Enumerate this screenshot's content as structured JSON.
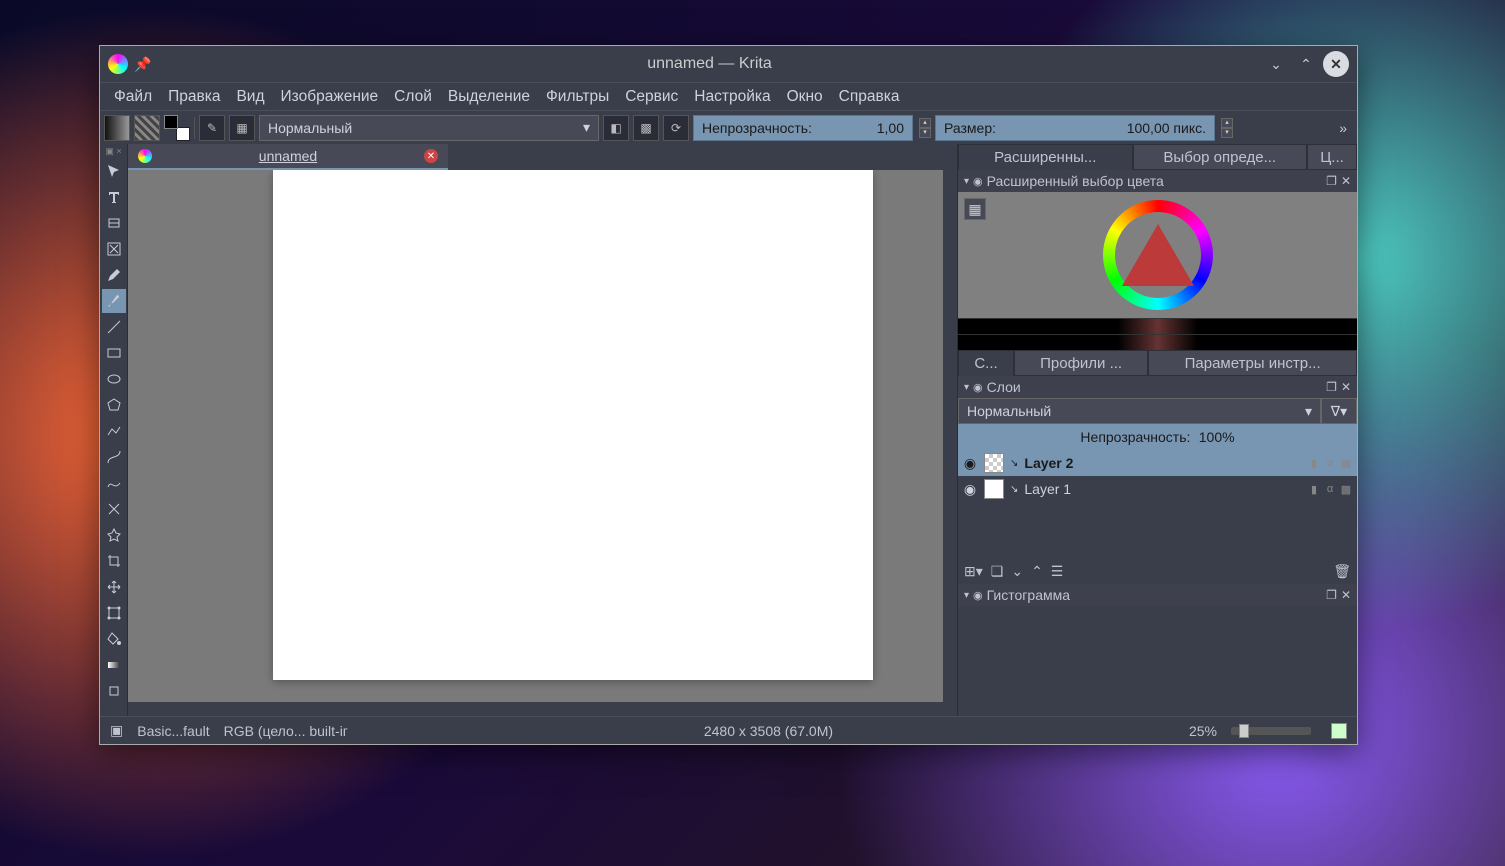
{
  "window": {
    "title": "unnamed  — Krita"
  },
  "menu": [
    "Файл",
    "Правка",
    "Вид",
    "Изображение",
    "Слой",
    "Выделение",
    "Фильтры",
    "Сервис",
    "Настройка",
    "Окно",
    "Справка"
  ],
  "toolbar": {
    "blend_mode": "Нормальный",
    "opacity_label": "Непрозрачность:",
    "opacity_value": "1,00",
    "size_label": "Размер:",
    "size_value": "100,00 пикс."
  },
  "document": {
    "tab_title": "unnamed"
  },
  "dockers": {
    "tabs": [
      "Расширенны...",
      "Выбор опреде...",
      "Ц..."
    ],
    "color_panel_title": "Расширенный выбор цвета",
    "mid_tabs": [
      "С...",
      "Профили ...",
      "Параметры инстр..."
    ],
    "layers_panel_title": "Слои",
    "layers": {
      "blend_mode": "Нормальный",
      "opacity_label": "Непрозрачность:",
      "opacity_value": "100%",
      "items": [
        {
          "name": "Layer 2",
          "selected": true,
          "thumb": "checker"
        },
        {
          "name": "Layer 1",
          "selected": false,
          "thumb": "white"
        }
      ]
    },
    "histogram_title": "Гистограмма"
  },
  "status": {
    "brush": "Basic...fault",
    "color_model": "RGB (цело... built-iг",
    "dimensions": "2480 x 3508 (67.0M)",
    "zoom": "25%"
  }
}
